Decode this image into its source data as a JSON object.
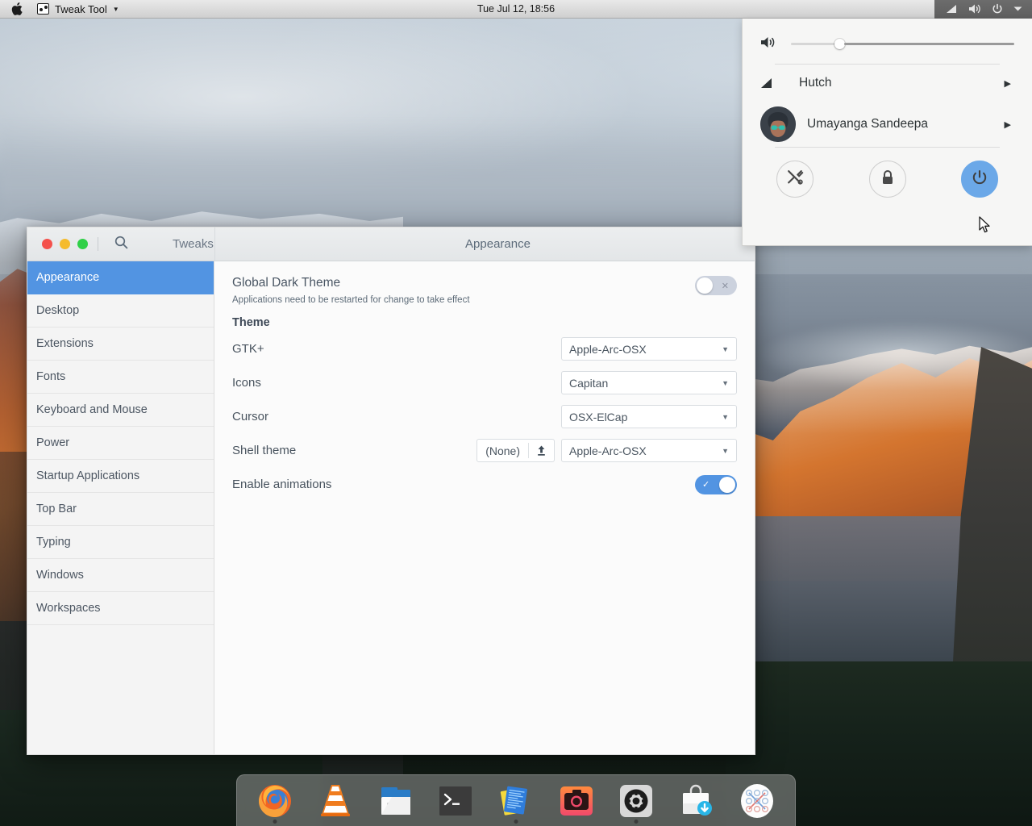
{
  "topbar": {
    "apple_icon": "apple-logo-icon",
    "app_icon": "tweak-tool-icon",
    "app_name": "Tweak Tool",
    "app_caret": "▼",
    "clock": "Tue Jul 12, 18:56",
    "indicators": [
      {
        "name": "network-signal-icon"
      },
      {
        "name": "volume-icon"
      },
      {
        "name": "power-icon"
      },
      {
        "name": "chevron-down-icon"
      }
    ]
  },
  "system_menu": {
    "volume": {
      "icon": "volume-icon",
      "level_percent": 20
    },
    "network": {
      "icon": "network-signal-icon",
      "label": "Hutch",
      "arrow": "▶"
    },
    "user": {
      "avatar": "user-avatar",
      "label": "Umayanga Sandeepa",
      "arrow": "▶"
    },
    "actions": [
      {
        "name": "settings-button",
        "icon": "tools-icon",
        "label": "Settings"
      },
      {
        "name": "lock-button",
        "icon": "lock-icon",
        "label": "Lock"
      },
      {
        "name": "power-button",
        "icon": "power-icon",
        "label": "Power Off",
        "highlight_color": "#6ba8e8"
      }
    ]
  },
  "tweak_window": {
    "left_title": "Tweaks",
    "center_title": "Appearance",
    "search_icon": "search-icon",
    "traffic_lights": [
      {
        "name": "close-button",
        "color": "#f4514c"
      },
      {
        "name": "minimize-button",
        "color": "#f5bb2c"
      },
      {
        "name": "maximize-button",
        "color": "#2fd047"
      }
    ],
    "sidebar": [
      {
        "label": "Appearance",
        "active": true
      },
      {
        "label": "Desktop",
        "active": false
      },
      {
        "label": "Extensions",
        "active": false
      },
      {
        "label": "Fonts",
        "active": false
      },
      {
        "label": "Keyboard and Mouse",
        "active": false
      },
      {
        "label": "Power",
        "active": false
      },
      {
        "label": "Startup Applications",
        "active": false
      },
      {
        "label": "Top Bar",
        "active": false
      },
      {
        "label": "Typing",
        "active": false
      },
      {
        "label": "Windows",
        "active": false
      },
      {
        "label": "Workspaces",
        "active": false
      }
    ],
    "content": {
      "global_dark": {
        "title": "Global Dark Theme",
        "subtitle": "Applications need to be restarted for change to take effect",
        "toggle_state": "off",
        "toggle_mark": "✕"
      },
      "section_title": "Theme",
      "rows": [
        {
          "label": "GTK+",
          "value": "Apple-Arc-OSX",
          "arrow": "▼"
        },
        {
          "label": "Icons",
          "value": "Capitan",
          "arrow": "▼"
        },
        {
          "label": "Cursor",
          "value": "OSX-ElCap",
          "arrow": "▼"
        },
        {
          "label": "Shell theme",
          "value": "Apple-Arc-OSX",
          "arrow": "▼",
          "none_label": "(None)",
          "upload_icon": "upload-icon"
        }
      ],
      "animations": {
        "label": "Enable animations",
        "toggle_state": "on",
        "toggle_mark": "✓"
      }
    }
  },
  "dock": {
    "items": [
      {
        "name": "firefox",
        "label": "Firefox",
        "running": true
      },
      {
        "name": "vlc",
        "label": "VLC Media Player",
        "running": false
      },
      {
        "name": "files",
        "label": "Files",
        "running": false
      },
      {
        "name": "terminal",
        "label": "Terminal",
        "running": false
      },
      {
        "name": "text-editor",
        "label": "Text Editor",
        "running": true
      },
      {
        "name": "camera",
        "label": "Cheese",
        "running": false
      },
      {
        "name": "settings",
        "label": "Settings",
        "running": true
      },
      {
        "name": "software",
        "label": "Software",
        "running": false
      },
      {
        "name": "xapp",
        "label": "X Application",
        "running": false
      }
    ]
  },
  "colors": {
    "accent_blue": "#5294e2",
    "menu_blue": "#6ba8e8",
    "topbar_bg": "#dcdcdc",
    "sidebar_bg": "#f4f4f4"
  }
}
